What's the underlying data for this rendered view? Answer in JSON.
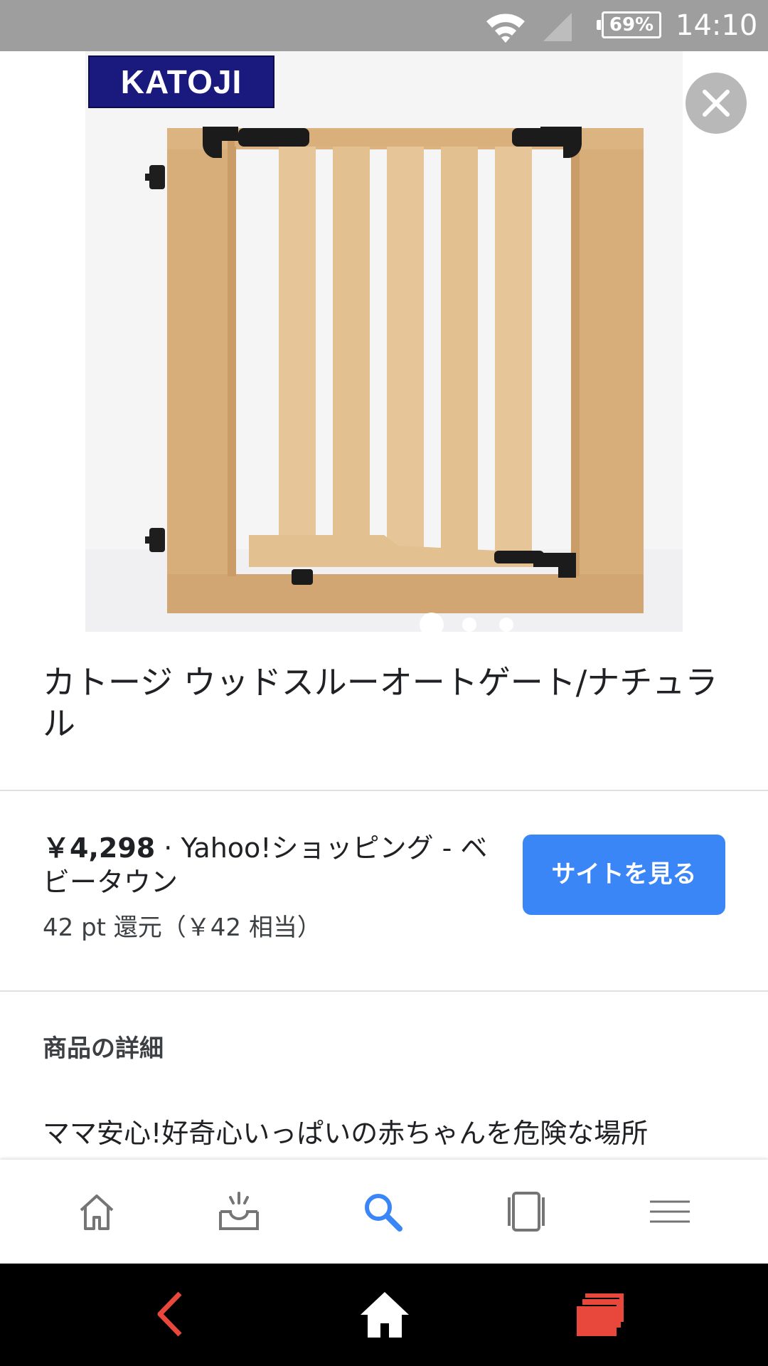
{
  "status_bar": {
    "battery": "69%",
    "time": "14:10",
    "icons": [
      "wifi-icon",
      "cell-signal-icon",
      "battery-icon"
    ]
  },
  "product": {
    "brand_logo": "KATOJI",
    "title": "カトージ ウッドスルーオートゲート/ナチュラル",
    "image_count": 3,
    "active_image": 1
  },
  "offer": {
    "price": "￥4,298",
    "separator": " · ",
    "store": "Yahoo!ショッピング - ベビータウン",
    "points": "42 pt 還元（￥42 相当）",
    "visit_label": "サイトを見る"
  },
  "details": {
    "heading": "商品の詳細",
    "text": "ママ安心!好奇心いっぱいの赤ちゃんを危険な場所"
  },
  "app_nav": {
    "items": [
      "home-icon",
      "inbox-icon",
      "search-icon",
      "tabs-icon",
      "menu-icon"
    ],
    "active": "search-icon",
    "active_color": "#3b86f7"
  },
  "system_nav": {
    "items": [
      "back-icon",
      "home-icon",
      "recents-icon"
    ],
    "colors": {
      "back": "#e8483b",
      "recents": "#e8483b"
    }
  },
  "colors": {
    "status_bar": "#9e9e9e",
    "accent": "#3b86f7"
  }
}
